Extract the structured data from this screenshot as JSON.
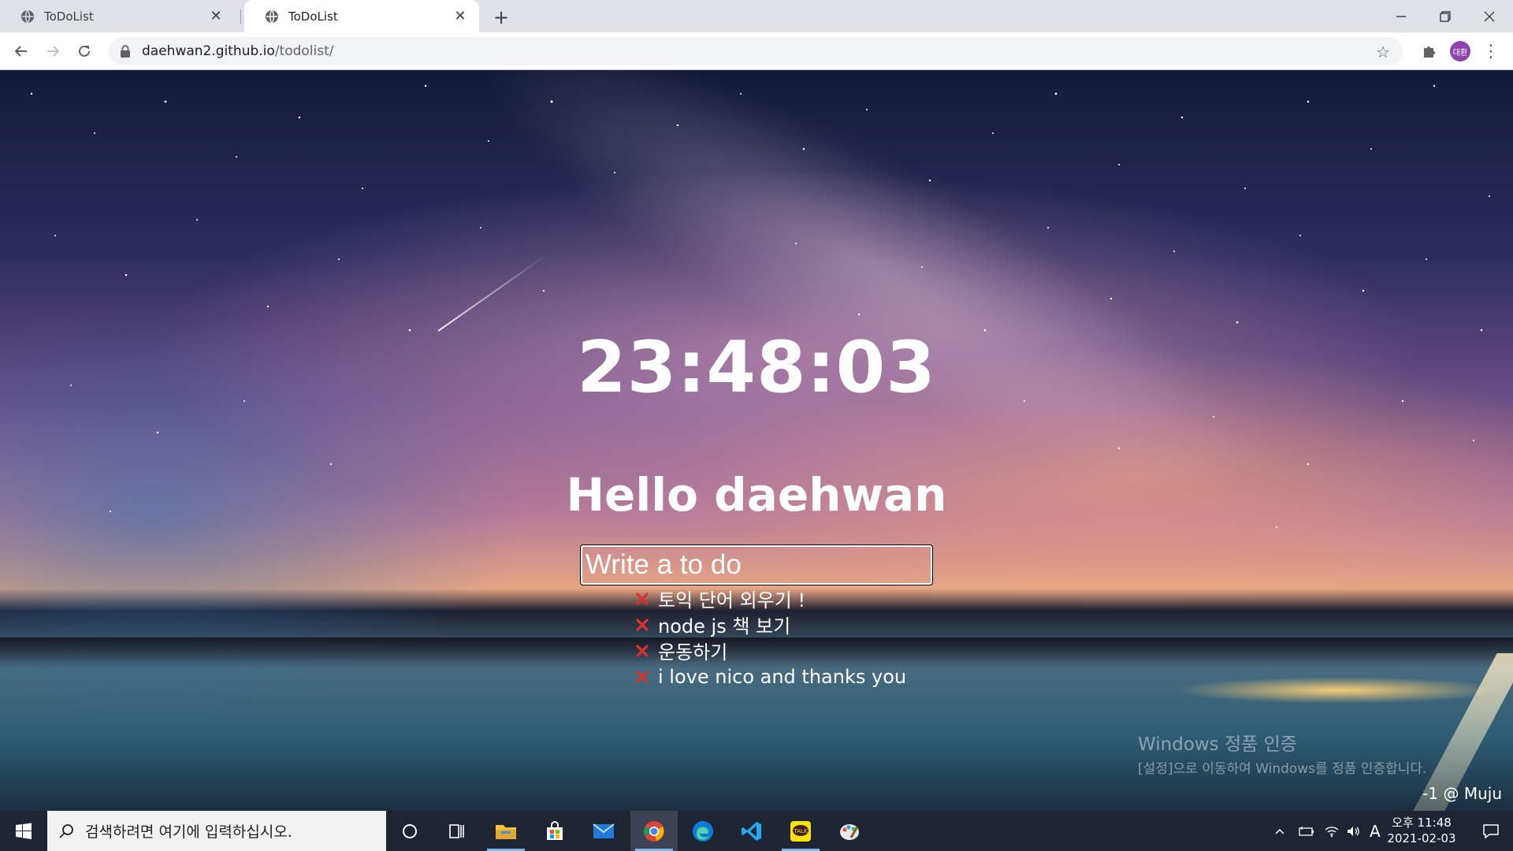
{
  "browser": {
    "tabs": [
      {
        "title": "ToDoList",
        "active": false
      },
      {
        "title": "ToDoList",
        "active": true
      }
    ],
    "new_tab_label": "+",
    "url_host": "daehwan2.github.io",
    "url_path": "/todolist/",
    "profile_initials": "대환"
  },
  "page": {
    "clock": "23:48:03",
    "greeting": "Hello daehwan",
    "input_placeholder": "Write a to do",
    "todos": [
      {
        "text": "토익 단어 외우기 !"
      },
      {
        "text": "node js 책 보기"
      },
      {
        "text": "운동하기"
      },
      {
        "text": "i love nico and thanks you"
      }
    ],
    "watermark_line1": "Windows 정품 인증",
    "watermark_line2": "[설정]으로 이동하여 Windows를 정품 인증합니다.",
    "photo_credit": "-1 @ Muju"
  },
  "taskbar": {
    "search_placeholder": "검색하려면 여기에 입력하십시오.",
    "ime_indicator": "A",
    "time": "오후 11:48",
    "date": "2021-02-03",
    "apps": [
      "cortana-icon",
      "task-view-icon",
      "file-explorer-icon",
      "store-icon",
      "mail-icon",
      "chrome-icon",
      "edge-icon",
      "vscode-icon",
      "kakaotalk-icon",
      "paint-icon"
    ]
  },
  "colors": {
    "tabstrip": "#dee1e6",
    "taskbar": "#1d2432",
    "delete_icon": "#e0302a",
    "avatar": "#8e44ad"
  }
}
